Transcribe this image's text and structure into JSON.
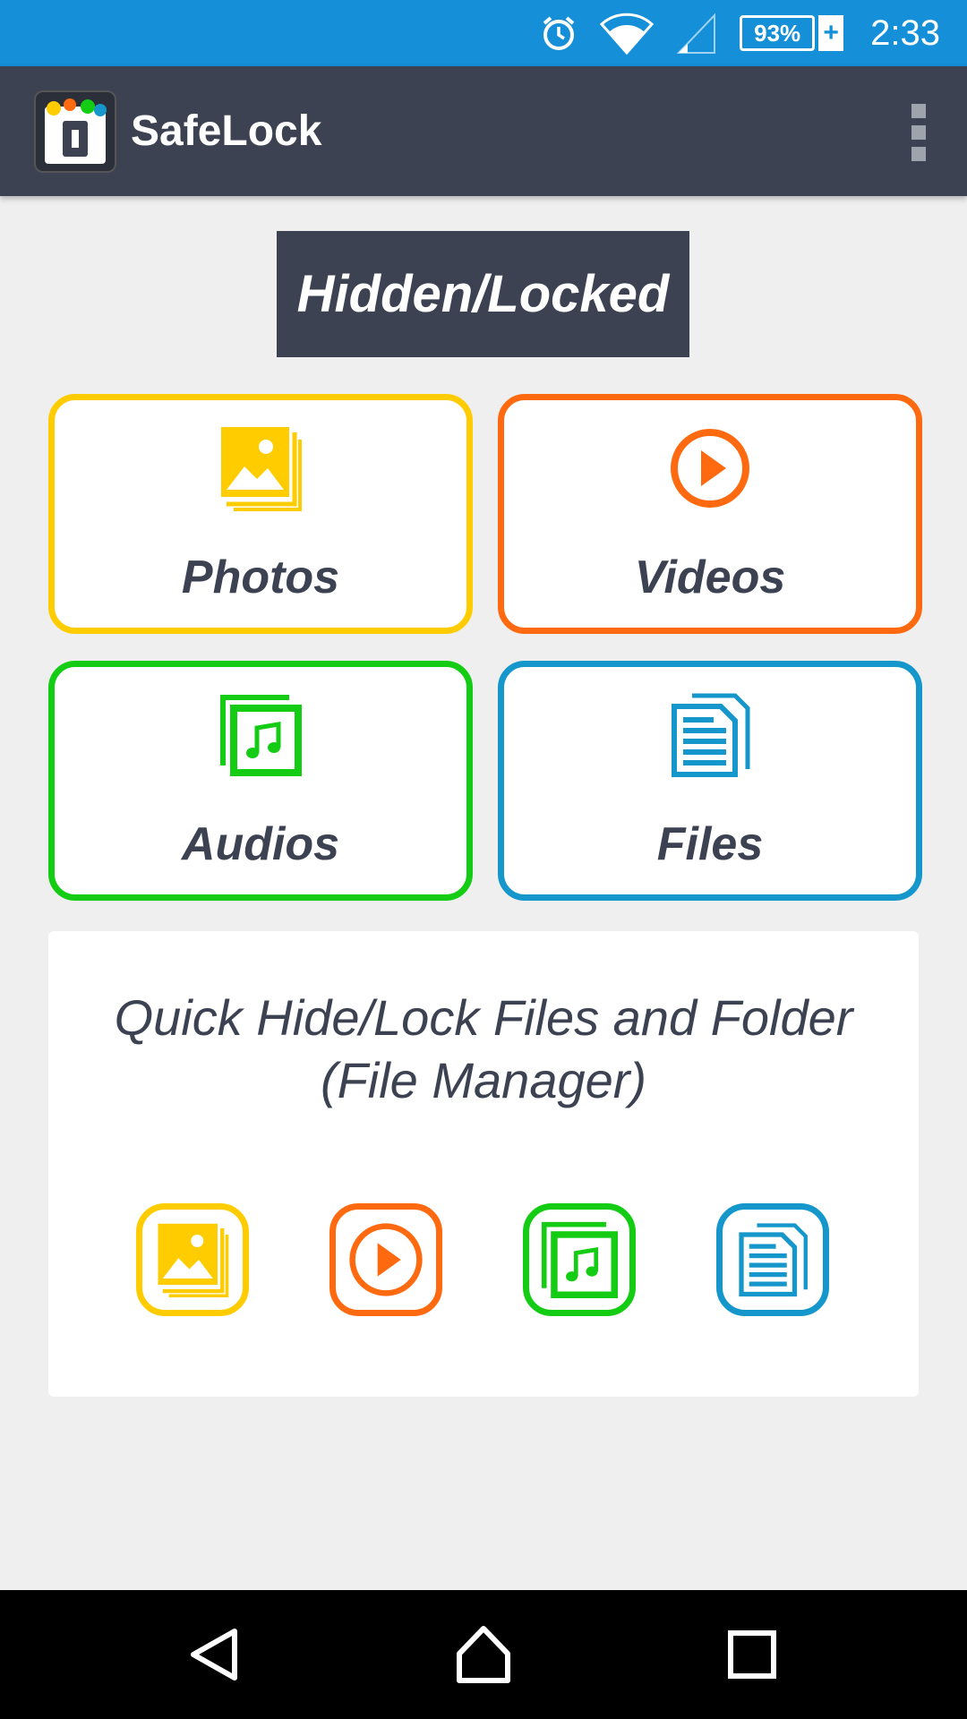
{
  "status_bar": {
    "battery_percent": "93%",
    "battery_plus": "+",
    "time": "2:33",
    "icons": [
      "alarm-icon",
      "wifi-icon",
      "cell-signal-icon",
      "battery-icon"
    ]
  },
  "app_bar": {
    "title": "SafeLock",
    "menu_icon": "more-vert-icon"
  },
  "section": {
    "heading": "Hidden/Locked"
  },
  "categories": [
    {
      "label": "Photos",
      "icon": "photos-icon",
      "color": "#ffcc00"
    },
    {
      "label": "Videos",
      "icon": "play-icon",
      "color": "#ff6a10"
    },
    {
      "label": "Audios",
      "icon": "music-icon",
      "color": "#14cc14"
    },
    {
      "label": "Files",
      "icon": "document-icon",
      "color": "#1597cc"
    }
  ],
  "quick": {
    "title_line1": "Quick Hide/Lock Files and Folder",
    "title_line2": "(File Manager)",
    "buttons": [
      {
        "icon": "photos-icon",
        "color": "#ffcc00"
      },
      {
        "icon": "play-icon",
        "color": "#ff6a10"
      },
      {
        "icon": "music-icon",
        "color": "#14cc14"
      },
      {
        "icon": "document-icon",
        "color": "#1597cc"
      }
    ]
  },
  "nav": {
    "icons": [
      "back-icon",
      "home-icon",
      "recents-icon"
    ]
  }
}
